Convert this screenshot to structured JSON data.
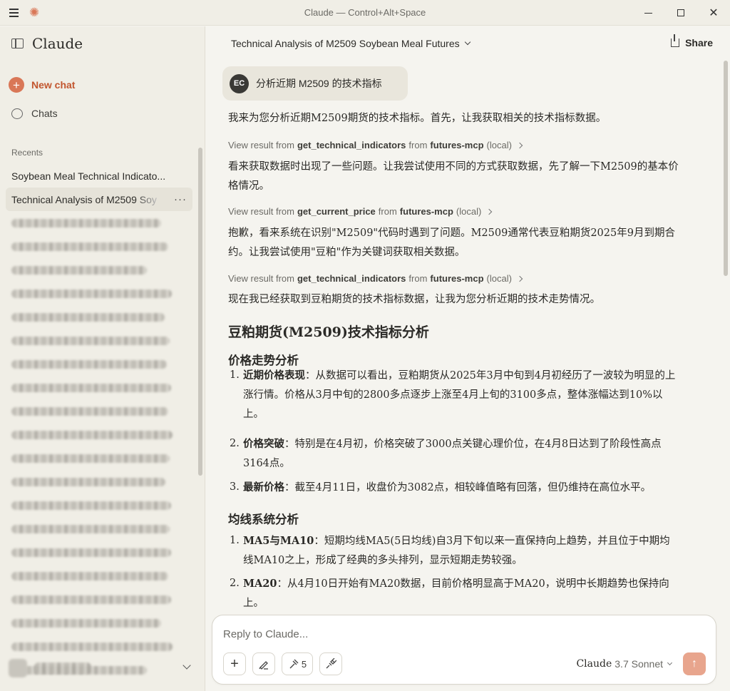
{
  "window": {
    "title": "Claude — Control+Alt+Space"
  },
  "sidebar": {
    "brand": "Claude",
    "new_chat": "New chat",
    "chats": "Chats",
    "recents_label": "Recents",
    "recents": [
      "Soybean Meal Technical Indicato...",
      "Technical Analysis of M2509 Soy"
    ]
  },
  "header": {
    "conversation_title": "Technical Analysis of M2509 Soybean Meal Futures",
    "share": "Share"
  },
  "conversation": {
    "user_initials": "EC",
    "user_message": "分析近期 M2509 的技术指标",
    "p1": "我来为您分析近期M2509期货的技术指标。首先，让我获取相关的技术指标数据。",
    "tool_calls": [
      {
        "prefix": "View result from",
        "tool": "get_technical_indicators",
        "mid": "from",
        "server": "futures-mcp",
        "suffix": "(local)"
      },
      {
        "prefix": "View result from",
        "tool": "get_current_price",
        "mid": "from",
        "server": "futures-mcp",
        "suffix": "(local)"
      },
      {
        "prefix": "View result from",
        "tool": "get_technical_indicators",
        "mid": "from",
        "server": "futures-mcp",
        "suffix": "(local)"
      }
    ],
    "p2": "看来获取数据时出现了一些问题。让我尝试使用不同的方式获取数据，先了解一下M2509的基本价格情况。",
    "p3": "抱歉，看来系统在识别\"M2509\"代码时遇到了问题。M2509通常代表豆粕期货2025年9月到期合约。让我尝试使用\"豆粕\"作为关键词获取相关数据。",
    "p4": "现在我已经获取到豆粕期货的技术指标数据，让我为您分析近期的技术走势情况。",
    "h_main": "豆粕期货(M2509)技术指标分析",
    "h_price": "价格走势分析",
    "price_items": [
      {
        "n": "1.",
        "k": "近期价格表现",
        "v": "：从数据可以看出，豆粕期货从2025年3月中旬到4月初经历了一波较为明显的上涨行情。价格从3月中旬的2800多点逐步上涨至4月上旬的3100多点，整体涨幅达到10%以上。"
      },
      {
        "n": "2.",
        "k": "价格突破",
        "v": "：特别是在4月初，价格突破了3000点关键心理价位，在4月8日达到了阶段性高点3164点。"
      },
      {
        "n": "3.",
        "k": "最新价格",
        "v": "：截至4月11日，收盘价为3082点，相较峰值略有回落，但仍维持在高位水平。"
      }
    ],
    "h_ma": "均线系统分析",
    "ma_items": [
      {
        "n": "1.",
        "k": "MA5与MA10",
        "v": "：短期均线MA5(5日均线)自3月下旬以来一直保持向上趋势，并且位于中期均线MA10之上，形成了经典的多头排列，显示短期走势较强。"
      },
      {
        "n": "2.",
        "k": "MA20",
        "v": "：从4月10日开始有MA20数据，目前价格明显高于MA20，说明中长期趋势也保持向上。"
      }
    ]
  },
  "composer": {
    "placeholder": "Reply to Claude...",
    "tools_count": "5",
    "model_name": "Claude",
    "model_version": "3.7 Sonnet"
  }
}
